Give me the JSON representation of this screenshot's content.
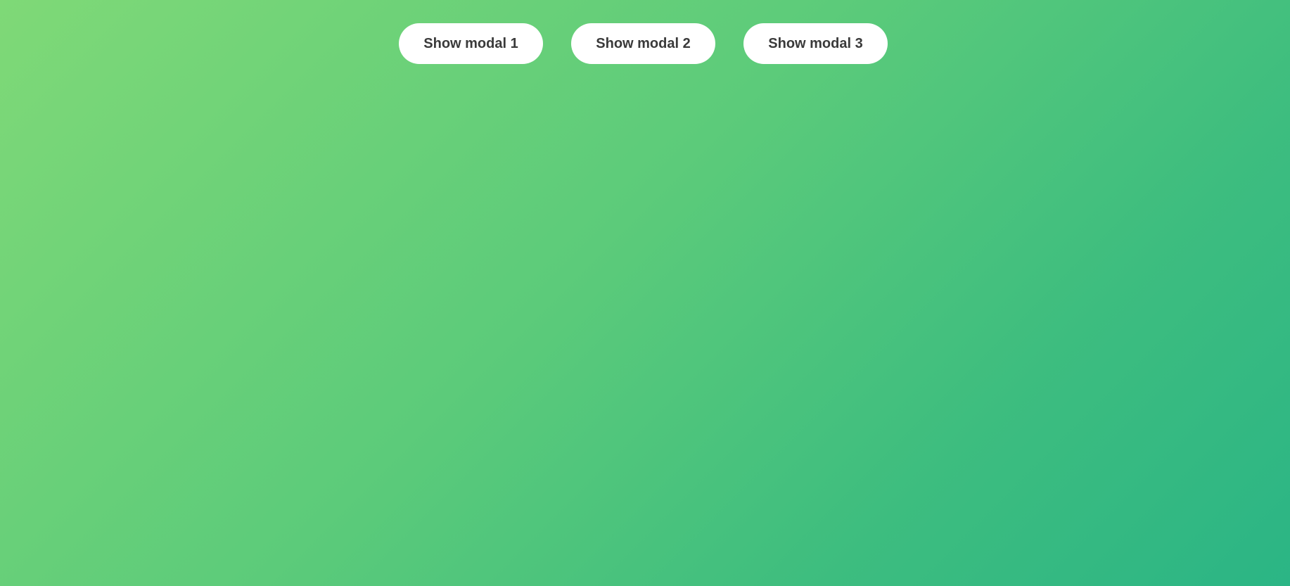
{
  "colors": {
    "background_gradient_start": "#7fd977",
    "background_gradient_end": "#2bb585",
    "button_background": "#ffffff",
    "button_text": "#3a3a3a"
  },
  "toolbar": {
    "buttons": [
      {
        "label": "Show modal 1"
      },
      {
        "label": "Show modal 2"
      },
      {
        "label": "Show modal 3"
      }
    ]
  }
}
